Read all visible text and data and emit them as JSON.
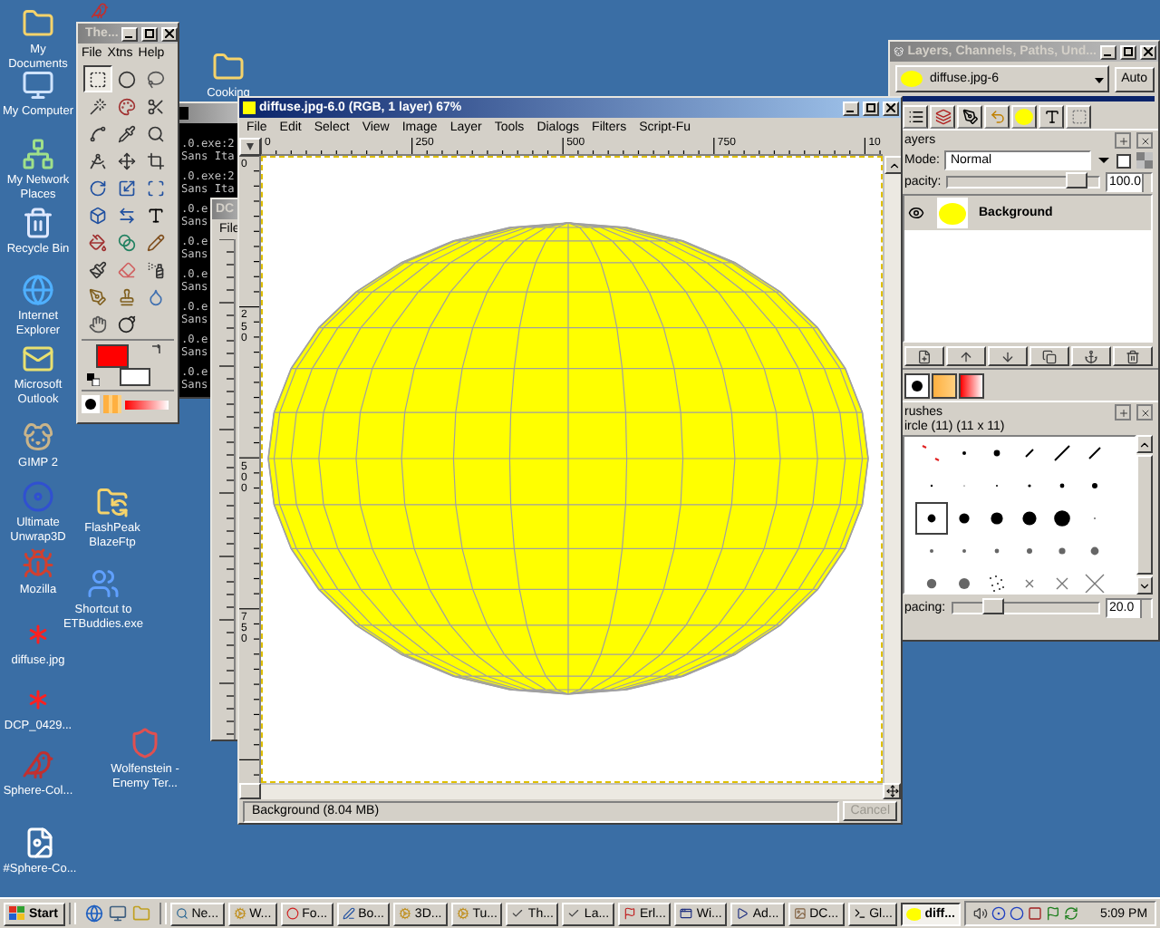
{
  "desktop_icons": [
    {
      "label": "My Documents",
      "kind": "folder"
    },
    {
      "label": "My Computer",
      "kind": "computer"
    },
    {
      "label": "My Network Places",
      "kind": "network"
    },
    {
      "label": "Recycle Bin",
      "kind": "recycle-bin"
    },
    {
      "label": "Internet Explorer",
      "kind": "browser"
    },
    {
      "label": "Microsoft Outlook",
      "kind": "mail"
    },
    {
      "label": "GIMP 2",
      "kind": "gimp"
    },
    {
      "label": "Ultimate Unwrap3D",
      "kind": "disc"
    },
    {
      "label": "FlashPeak BlazeFtp",
      "kind": "ftp"
    },
    {
      "label": "Mozilla",
      "kind": "bug"
    },
    {
      "label": "Shortcut to ETBuddies.exe",
      "kind": "users"
    },
    {
      "label": "diffuse.jpg",
      "kind": "splat"
    },
    {
      "label": "DCP_0429...",
      "kind": "splat"
    },
    {
      "label": "Wolfenstein - Enemy Ter...",
      "kind": "shield"
    },
    {
      "label": "Sphere-Col...",
      "kind": "bird"
    },
    {
      "label": "#Sphere-Co...",
      "kind": "image-file"
    },
    {
      "label": "Cooking",
      "kind": "folder"
    },
    {
      "kind": "bird"
    }
  ],
  "console": {
    "active": false,
    "lines": [
      ".0.exe:2",
      "Sans Ita",
      ".0.exe:2",
      "Sans Ita",
      ".0.e",
      "Sans",
      ".0.e",
      "Sans",
      ".0.e",
      "Sans",
      ".0.e",
      "Sans",
      ".0.e",
      "Sans",
      ".0.e",
      "Sans"
    ]
  },
  "second_image_window": {
    "title": "DC",
    "active": false,
    "menu": [
      "File"
    ]
  },
  "toolbox": {
    "title": "The...",
    "active": false,
    "menu": [
      "File",
      "Xtns",
      "Help"
    ],
    "tools": [
      {
        "kind": "rect-select",
        "selected": true
      },
      {
        "kind": "ellipse-select",
        "selected": false
      },
      {
        "kind": "lasso",
        "selected": false
      },
      {
        "kind": "wand",
        "selected": false
      },
      {
        "kind": "color-select",
        "selected": false
      },
      {
        "kind": "scissors",
        "selected": false
      },
      {
        "kind": "paths",
        "selected": false
      },
      {
        "kind": "picker",
        "selected": false
      },
      {
        "kind": "zoom",
        "selected": false
      },
      {
        "kind": "measure",
        "selected": false
      },
      {
        "kind": "move",
        "selected": false
      },
      {
        "kind": "crop",
        "selected": false
      },
      {
        "kind": "rotate",
        "selected": false
      },
      {
        "kind": "scale",
        "selected": false
      },
      {
        "kind": "shear",
        "selected": false
      },
      {
        "kind": "perspective",
        "selected": false
      },
      {
        "kind": "flip",
        "selected": false
      },
      {
        "kind": "text",
        "selected": false
      },
      {
        "kind": "fill",
        "selected": false
      },
      {
        "kind": "gradient",
        "selected": false
      },
      {
        "kind": "pencil",
        "selected": false
      },
      {
        "kind": "brush",
        "selected": false
      },
      {
        "kind": "eraser",
        "selected": false
      },
      {
        "kind": "airbrush",
        "selected": false
      },
      {
        "kind": "ink",
        "selected": false
      },
      {
        "kind": "clone",
        "selected": false
      },
      {
        "kind": "blur",
        "selected": false
      },
      {
        "kind": "smudge",
        "selected": false
      },
      {
        "kind": "dodge",
        "selected": false
      }
    ],
    "colors": [
      {
        "kind": "foreground",
        "color": "#ff0000"
      },
      {
        "kind": "background",
        "color": "#ffffff"
      }
    ]
  },
  "image_window": {
    "title": "diffuse.jpg-6.0 (RGB, 1 layer) 67%",
    "active": true,
    "menu": [
      "File",
      "Edit",
      "Select",
      "View",
      "Image",
      "Layer",
      "Tools",
      "Dialogs",
      "Filters",
      "Script-Fu"
    ],
    "top_ruler": [
      "0",
      "250",
      "500",
      "750",
      "10"
    ],
    "left_ruler": [
      "0",
      "250",
      "500",
      "750"
    ],
    "status": "Background (8.04 MB)",
    "cancel": {
      "label": "Cancel",
      "disabled": true
    }
  },
  "layers_dialog": {
    "title": "Layers, Channels, Paths, Und...",
    "active": false,
    "image": "diffuse.jpg-6",
    "auto_button": "Auto",
    "layers_panel": {
      "title": "ayers",
      "mode_label": "Mode:",
      "mode": "Normal",
      "keep_transparency": false,
      "opacity": {
        "label": "pacity:",
        "level": 0.93,
        "reading": "100.0"
      }
    },
    "layers": [
      {
        "name": "Background",
        "visible": true,
        "selected": true
      }
    ],
    "brushes_panel": {
      "title": "rushes",
      "brush_name": "ircle (11) (11 x 11)",
      "spacing": {
        "label": "pacing:",
        "level": 0.2,
        "reading": "20.0"
      }
    },
    "brushes": [
      {
        "selected": false
      },
      {
        "selected": false
      },
      {
        "selected": false
      },
      {
        "selected": false
      },
      {
        "selected": false
      },
      {
        "selected": false
      },
      {
        "selected": false
      },
      {
        "selected": false
      },
      {
        "selected": false
      },
      {
        "selected": false
      },
      {
        "selected": false
      },
      {
        "selected": false
      },
      {
        "selected": true
      },
      {
        "selected": false
      },
      {
        "selected": false
      },
      {
        "selected": false
      },
      {
        "selected": false
      },
      {
        "selected": false
      },
      {
        "selected": false
      },
      {
        "selected": false
      },
      {
        "selected": false
      },
      {
        "selected": false
      },
      {
        "selected": false
      },
      {
        "selected": false
      },
      {
        "selected": false
      },
      {
        "selected": false
      },
      {
        "selected": false
      },
      {
        "selected": false
      },
      {
        "selected": false
      },
      {
        "selected": false
      }
    ]
  },
  "taskbar": {
    "start": "Start",
    "tasks": [
      {
        "label": "Ne...",
        "kind": "search",
        "selected": false
      },
      {
        "label": "W...",
        "kind": "cog",
        "selected": false
      },
      {
        "label": "Fo...",
        "kind": "circle",
        "selected": false
      },
      {
        "label": "Bo...",
        "kind": "pen",
        "selected": false
      },
      {
        "label": "3D...",
        "kind": "cog",
        "selected": false
      },
      {
        "label": "Tu...",
        "kind": "cog",
        "selected": false
      },
      {
        "label": "Th...",
        "kind": "check",
        "selected": false
      },
      {
        "label": "La...",
        "kind": "check",
        "selected": false
      },
      {
        "label": "Erl...",
        "kind": "flag",
        "selected": false
      },
      {
        "label": "Wi...",
        "kind": "window",
        "selected": false
      },
      {
        "label": "Ad...",
        "kind": "play",
        "selected": false
      },
      {
        "label": "DC...",
        "kind": "image",
        "selected": false
      },
      {
        "label": "Gl...",
        "kind": "terminal",
        "selected": false
      },
      {
        "label": "diff...",
        "kind": "swatch",
        "selected": true
      }
    ],
    "clock": "5:09 PM"
  }
}
